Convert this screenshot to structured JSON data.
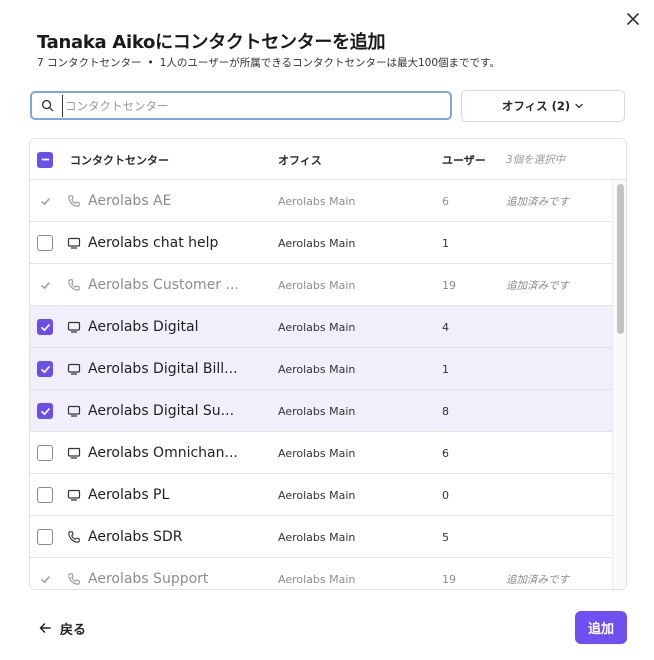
{
  "dialog": {
    "title": "Tanaka Aikoにコンタクトセンターを追加",
    "subtitle_count": "7 コンタクトセンター",
    "subtitle_sep": "•",
    "subtitle_note": "1人のユーザーが所属できるコンタクトセンターは最大100個までです。"
  },
  "search": {
    "placeholder": "コンタクトセンター",
    "value": ""
  },
  "filter": {
    "label": "オフィス (2)"
  },
  "table": {
    "headers": {
      "name": "コンタクトセンター",
      "office": "オフィス",
      "users": "ユーザー",
      "selected": "3個を選択中"
    },
    "rows": [
      {
        "name": "Aerolabs AE",
        "office": "Aerolabs Main",
        "users": "6",
        "status": "追加済みです"
      },
      {
        "name": "Aerolabs chat help",
        "office": "Aerolabs Main",
        "users": "1",
        "status": ""
      },
      {
        "name": "Aerolabs Customer ...",
        "office": "Aerolabs Main",
        "users": "19",
        "status": "追加済みです"
      },
      {
        "name": "Aerolabs Digital",
        "office": "Aerolabs Main",
        "users": "4",
        "status": ""
      },
      {
        "name": "Aerolabs Digital Bill...",
        "office": "Aerolabs Main",
        "users": "1",
        "status": ""
      },
      {
        "name": "Aerolabs Digital Su...",
        "office": "Aerolabs Main",
        "users": "8",
        "status": ""
      },
      {
        "name": "Aerolabs Omnichan...",
        "office": "Aerolabs Main",
        "users": "6",
        "status": ""
      },
      {
        "name": "Aerolabs PL",
        "office": "Aerolabs Main",
        "users": "0",
        "status": ""
      },
      {
        "name": "Aerolabs SDR",
        "office": "Aerolabs Main",
        "users": "5",
        "status": ""
      },
      {
        "name": "Aerolabs Support",
        "office": "Aerolabs Main",
        "users": "19",
        "status": "追加済みです"
      }
    ]
  },
  "footer": {
    "back_label": "戻る",
    "add_label": "追加"
  },
  "colors": {
    "accent": "#6f4ff0",
    "selected_row": "#f1effb",
    "focus_border": "#7aa7e0"
  }
}
